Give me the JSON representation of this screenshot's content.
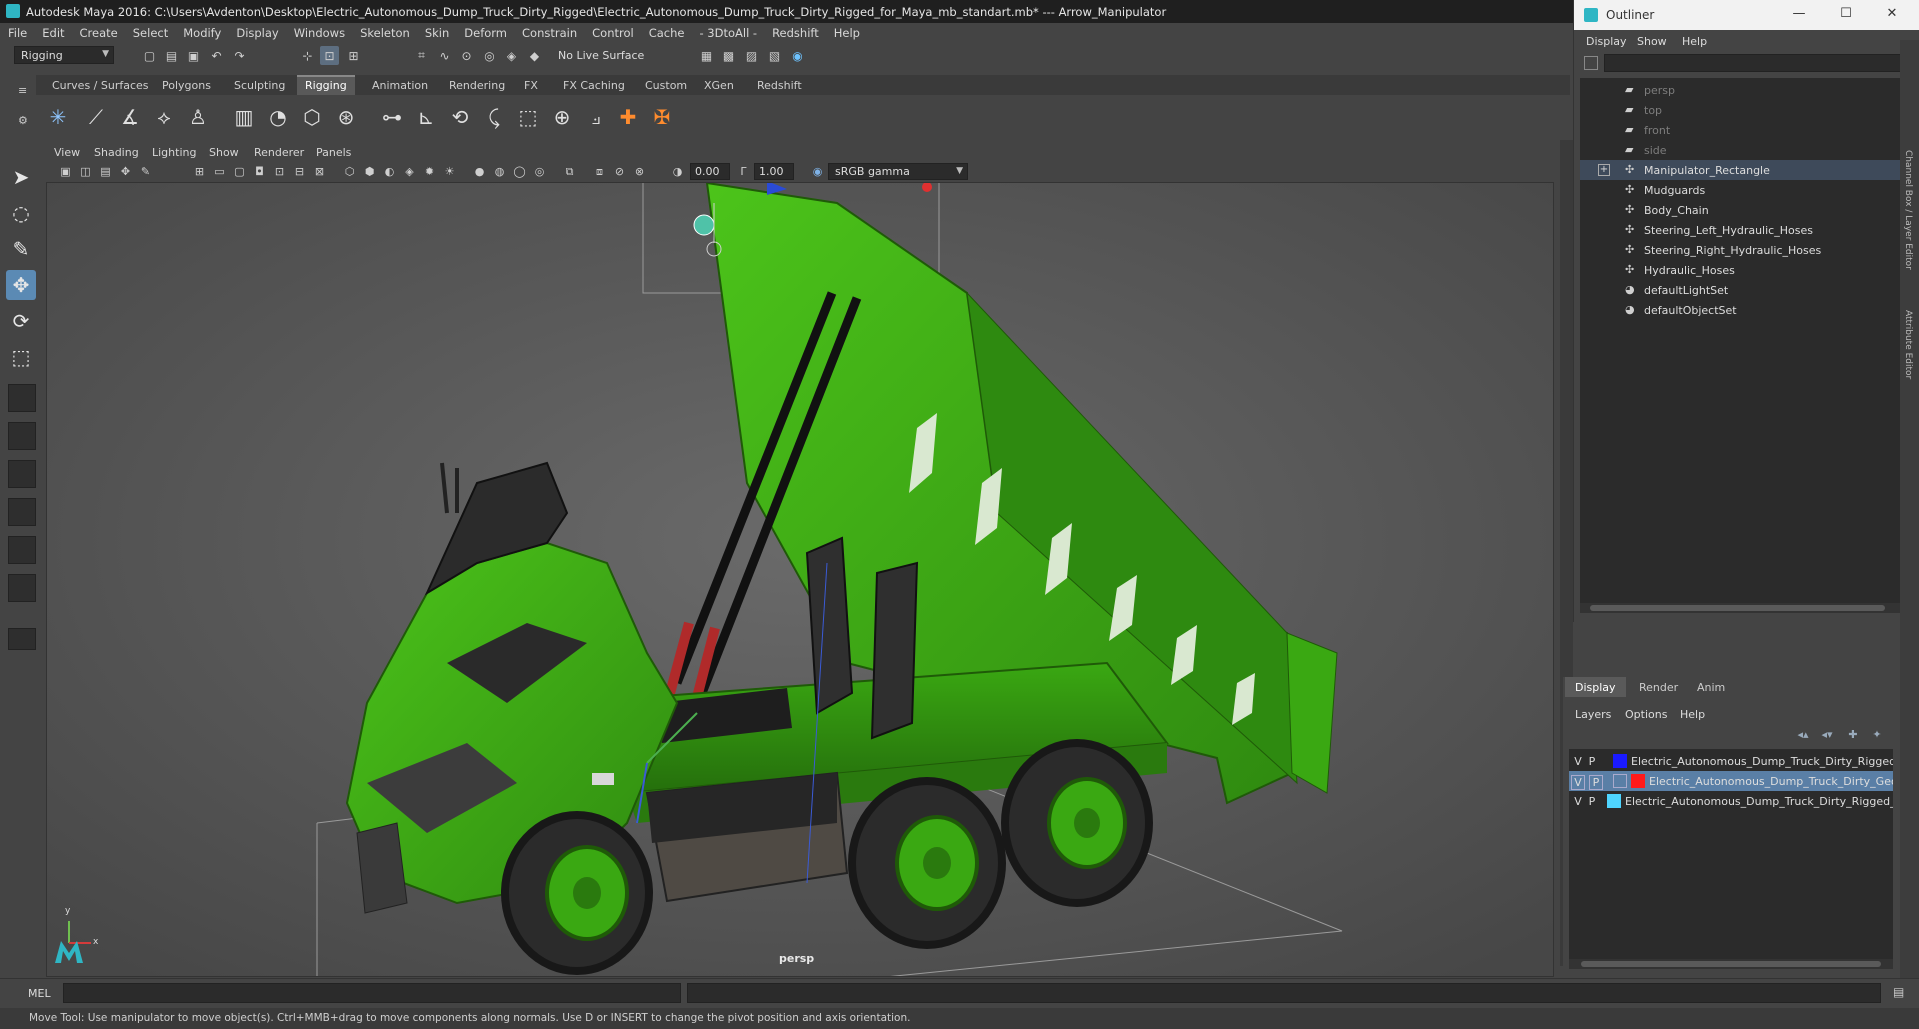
{
  "window": {
    "title": "Autodesk Maya 2016: C:\\Users\\Avdenton\\Desktop\\Electric_Autonomous_Dump_Truck_Dirty_Rigged\\Electric_Autonomous_Dump_Truck_Dirty_Rigged_for_Maya_mb_standart.mb*   ---   Arrow_Manipulator"
  },
  "menubar": [
    "File",
    "Edit",
    "Create",
    "Select",
    "Modify",
    "Display",
    "Windows",
    "Skeleton",
    "Skin",
    "Deform",
    "Constrain",
    "Control",
    "Cache",
    "- 3DtoAll -",
    "Redshift",
    "Help"
  ],
  "statusline": {
    "mode": "Rigging",
    "live_surface": "No Live Surface"
  },
  "shelf": {
    "tabs": [
      "Curves / Surfaces",
      "Polygons",
      "Sculpting",
      "Rigging",
      "Animation",
      "Rendering",
      "FX",
      "FX Caching",
      "Custom",
      "XGen",
      "Redshift"
    ],
    "active_tab": "Rigging"
  },
  "viewport": {
    "menu": [
      "View",
      "Shading",
      "Lighting",
      "Show",
      "Renderer",
      "Panels"
    ],
    "exposure": "0.00",
    "gamma": "1.00",
    "color_space": "sRGB gamma",
    "camera": "persp",
    "axis_y": "y",
    "axis_x": "x"
  },
  "outliner": {
    "title": "Outliner",
    "menu": [
      "Display",
      "Show",
      "Help"
    ],
    "items": [
      {
        "label": "persp",
        "kind": "camera",
        "dim": true
      },
      {
        "label": "top",
        "kind": "camera",
        "dim": true
      },
      {
        "label": "front",
        "kind": "camera",
        "dim": true
      },
      {
        "label": "side",
        "kind": "camera",
        "dim": true
      },
      {
        "label": "Manipulator_Rectangle",
        "kind": "transform",
        "selected": true,
        "expandable": true
      },
      {
        "label": "Mudguards",
        "kind": "transform"
      },
      {
        "label": "Body_Chain",
        "kind": "transform"
      },
      {
        "label": "Steering_Left_Hydraulic_Hoses",
        "kind": "transform"
      },
      {
        "label": "Steering_Right_Hydraulic_Hoses",
        "kind": "transform"
      },
      {
        "label": "Hydraulic_Hoses",
        "kind": "transform"
      },
      {
        "label": "defaultLightSet",
        "kind": "set"
      },
      {
        "label": "defaultObjectSet",
        "kind": "set"
      }
    ]
  },
  "layer_editor": {
    "tabs": [
      "Display",
      "Render",
      "Anim"
    ],
    "active_tab": "Display",
    "menu": [
      "Layers",
      "Options",
      "Help"
    ],
    "layers": [
      {
        "v": "V",
        "p": "P",
        "color": "#1a1aff",
        "name": "Electric_Autonomous_Dump_Truck_Dirty_Rigged_B"
      },
      {
        "v": "V",
        "p": "P",
        "color": "#ff1a1a",
        "name": "Electric_Autonomous_Dump_Truck_Dirty_Geor",
        "selected": true
      },
      {
        "v": "V",
        "p": "P",
        "color": "#4fd5ff",
        "name": "Electric_Autonomous_Dump_Truck_Dirty_Rigged_Co"
      }
    ]
  },
  "side_labels": [
    "Channel Box / Layer Editor",
    "Attribute Editor"
  ],
  "command_line": {
    "label": "MEL"
  },
  "help_line": "Move Tool: Use manipulator to move object(s). Ctrl+MMB+drag to move components along normals. Use D or INSERT to change the pivot position and axis orientation.",
  "colors": {
    "accent": "#5b8ab4",
    "truck_green": "#3fae14",
    "selection_row": "#3e4a5a"
  }
}
